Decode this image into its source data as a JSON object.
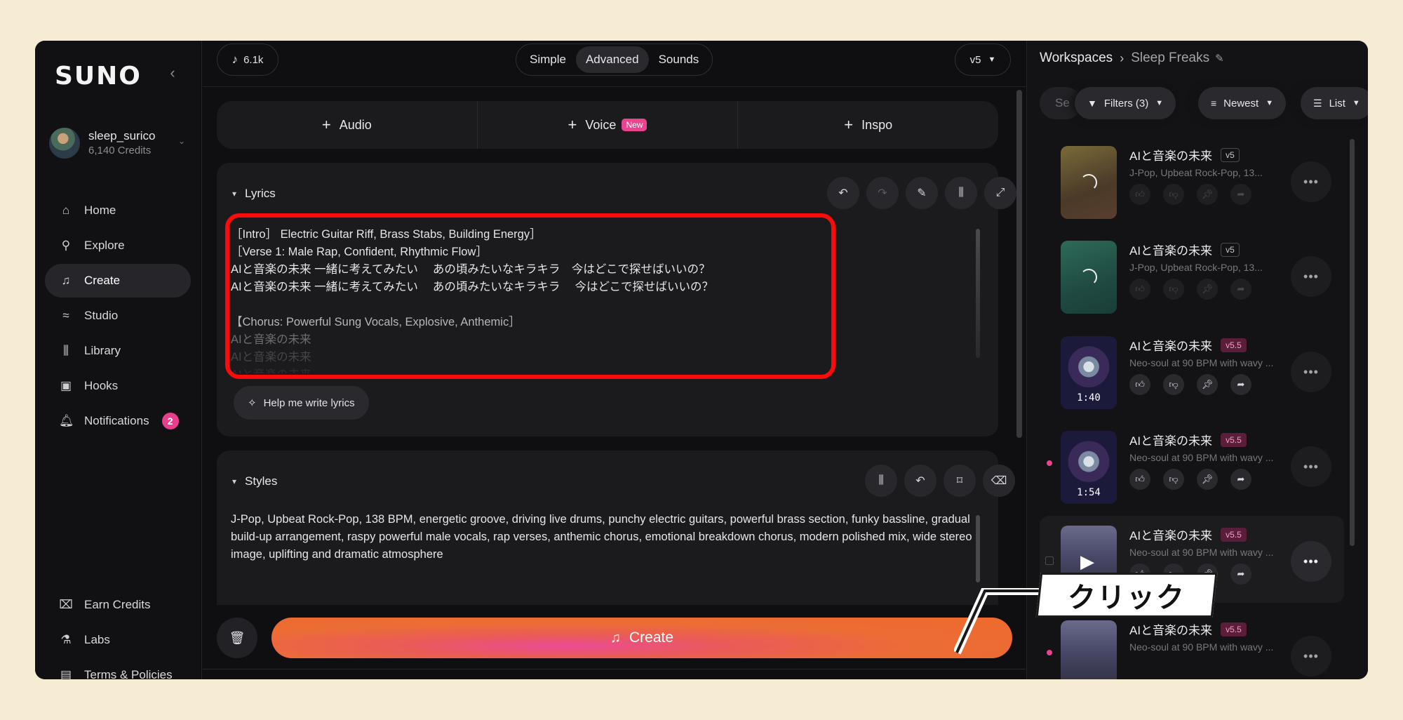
{
  "brand": {
    "logo": "SUNO"
  },
  "account": {
    "username": "sleep_surico",
    "credits": "6,140 Credits"
  },
  "nav": {
    "items": [
      {
        "label": "Home",
        "icon": "home-icon"
      },
      {
        "label": "Explore",
        "icon": "search-icon"
      },
      {
        "label": "Create",
        "icon": "music-create-icon",
        "active": true
      },
      {
        "label": "Studio",
        "icon": "studio-icon"
      },
      {
        "label": "Library",
        "icon": "library-icon"
      },
      {
        "label": "Hooks",
        "icon": "hooks-icon"
      },
      {
        "label": "Notifications",
        "icon": "bell-icon",
        "badge": "2"
      }
    ],
    "bottom": [
      {
        "label": "Earn Credits",
        "icon": "gift-icon"
      },
      {
        "label": "Labs",
        "icon": "flask-icon"
      },
      {
        "label": "Terms & Policies",
        "icon": "document-icon"
      }
    ]
  },
  "topbar": {
    "song_count": "6.1k",
    "modes": [
      "Simple",
      "Advanced",
      "Sounds"
    ],
    "active_mode": "Advanced",
    "model": "v5"
  },
  "add_bar": {
    "audio": "Audio",
    "voice": "Voice",
    "voice_badge": "New",
    "inspo": "Inspo"
  },
  "lyrics": {
    "title": "Lyrics",
    "lines": [
      "［Intro］ Electric Guitar Riff, Brass Stabs, Building Energy］",
      "［Verse 1: Male Rap, Confident, Rhythmic Flow］",
      "AIと音楽の未来 一緒に考えてみたい　 あの頃みたいなキラキラ　今はどこで探せばいいの？",
      "AIと音楽の未来 一緒に考えてみたい　 あの頃みたいなキラキラ　 今はどこで探せばいいの？",
      "",
      "【Chorus: Powerful Sung Vocals, Explosive, Anthemic］",
      "AIと音楽の未来",
      "AIと音楽の未来",
      "AIと音楽の未来"
    ],
    "help_label": "Help me write lyrics"
  },
  "styles": {
    "title": "Styles",
    "text": "J-Pop, Upbeat Rock-Pop, 138 BPM, energetic groove, driving live drums, punchy electric guitars, powerful brass section, funky bassline, gradual build-up arrangement, raspy powerful male vocals, rap verses, anthemic chorus, emotional breakdown chorus, modern polished mix, wide stereo image, uplifting and dramatic atmosphere"
  },
  "create": {
    "label": "Create"
  },
  "workspace": {
    "root": "Workspaces",
    "current": "Sleep Freaks",
    "search_placeholder": "Se",
    "filters": "Filters (3)",
    "sort": "Newest",
    "view": "List"
  },
  "songs": [
    {
      "title": "AIと音楽の未来",
      "version": "v5",
      "subtitle": "J-Pop, Upbeat Rock-Pop, 13...",
      "state": "loading",
      "thumb": "gold"
    },
    {
      "title": "AIと音楽の未来",
      "version": "v5",
      "subtitle": "J-Pop, Upbeat Rock-Pop, 13...",
      "state": "loading",
      "thumb": "teal"
    },
    {
      "title": "AIと音楽の未来",
      "version": "v5.5",
      "subtitle": "Neo-soul at 90 BPM with wavy ...",
      "duration": "1:40",
      "thumb": "art"
    },
    {
      "title": "AIと音楽の未来",
      "version": "v5.5",
      "subtitle": "Neo-soul at 90 BPM with wavy ...",
      "duration": "1:54",
      "thumb": "art",
      "new": true
    },
    {
      "title": "AIと音楽の未来",
      "version": "v5.5",
      "subtitle": "Neo-soul at 90 BPM with wavy ...",
      "thumb": "mtn",
      "hover": true
    },
    {
      "title": "AIと音楽の未来",
      "version": "v5.5",
      "subtitle": "Neo-soul at 90 BPM with wavy ...",
      "thumb": "mtn",
      "new": true
    }
  ],
  "callout": {
    "text": "クリック"
  },
  "colors": {
    "accent_pink": "#e8448f",
    "create_orange": "#ee6a2c",
    "highlight_red": "#ff0a0a",
    "backdrop": "#f6ecd3"
  }
}
